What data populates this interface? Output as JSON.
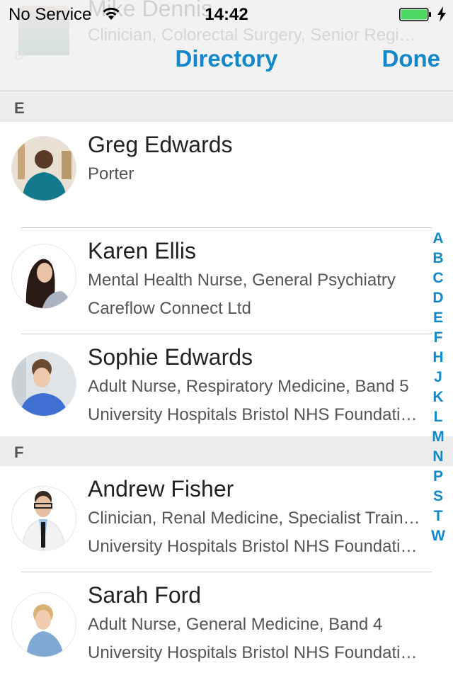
{
  "status_bar": {
    "carrier": "No Service",
    "time": "14:42",
    "battery_color": "#4cd964",
    "charging": true
  },
  "nav": {
    "title": "Directory",
    "done_label": "Done",
    "accent_color": "#1188c8"
  },
  "ghost_row": {
    "name": "Mike Dennis",
    "role": "Clinician, Colorectal Surgery, Senior Regi…",
    "section": "D"
  },
  "sections": [
    {
      "letter": "E",
      "contacts": [
        {
          "name": "Greg Edwards",
          "role": "Porter",
          "organisation": ""
        },
        {
          "name": "Karen Ellis",
          "role": "Mental Health Nurse, General Psychiatry",
          "organisation": "Careflow Connect Ltd"
        },
        {
          "name": "Sophie Edwards",
          "role": "Adult Nurse, Respiratory Medicine, Band 5",
          "organisation": "University Hospitals Bristol NHS Foundati…"
        }
      ]
    },
    {
      "letter": "F",
      "contacts": [
        {
          "name": "Andrew Fisher",
          "role": "Clinician, Renal Medicine, Specialist Train…",
          "organisation": "University Hospitals Bristol NHS Foundati…"
        },
        {
          "name": "Sarah Ford",
          "role": "Adult Nurse, General Medicine, Band 4",
          "organisation": "University Hospitals Bristol NHS Foundati…"
        }
      ]
    }
  ],
  "section_index": [
    "A",
    "B",
    "C",
    "D",
    "E",
    "F",
    "H",
    "J",
    "K",
    "L",
    "M",
    "N",
    "P",
    "S",
    "T",
    "W"
  ]
}
